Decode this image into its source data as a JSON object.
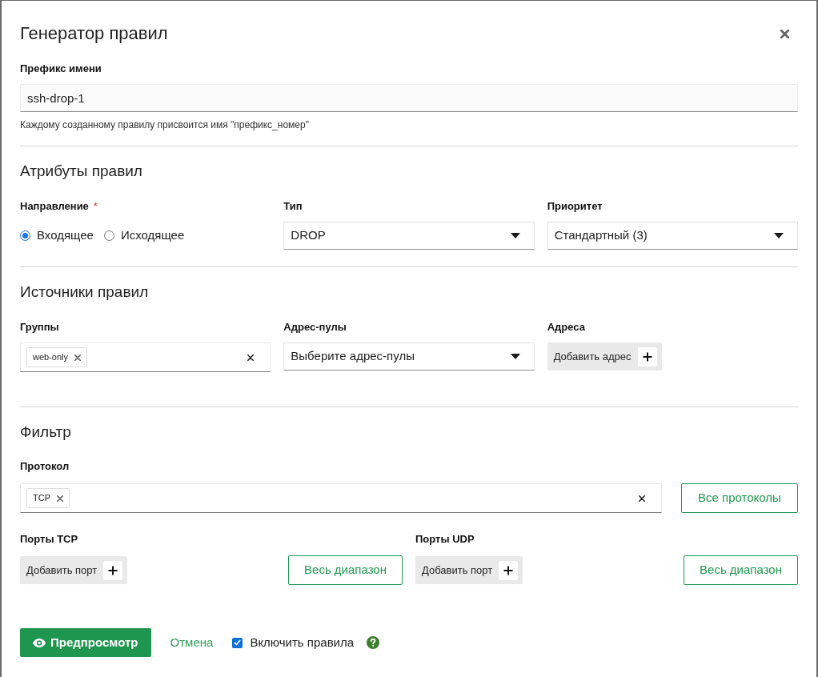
{
  "dialog": {
    "title": "Генератор правил"
  },
  "name_prefix": {
    "label": "Префикс имени",
    "value": "ssh-drop-1",
    "help": "Каждому созданному правилу присвоится имя \"префикс_номер\""
  },
  "rule_attributes": {
    "heading": "Атрибуты правил",
    "direction": {
      "label": "Направление",
      "required_mark": "*",
      "options": [
        {
          "label": "Входящее",
          "selected": true
        },
        {
          "label": "Исходящее",
          "selected": false
        }
      ]
    },
    "type": {
      "label": "Тип",
      "value": "DROP"
    },
    "priority": {
      "label": "Приоритет",
      "value": "Стандартный (3)"
    }
  },
  "rule_sources": {
    "heading": "Источники правил",
    "groups": {
      "label": "Группы",
      "tags": [
        "web-only"
      ]
    },
    "address_pools": {
      "label": "Адрес-пулы",
      "placeholder": "Выберите адрес-пулы"
    },
    "addresses": {
      "label": "Адреса",
      "add_button": "Добавить адрес"
    }
  },
  "filter": {
    "heading": "Фильтр",
    "protocol": {
      "label": "Протокол",
      "tags": [
        "TCP"
      ],
      "all_button": "Все протоколы"
    },
    "ports": [
      {
        "label": "Порты TCP",
        "add_button": "Добавить порт",
        "range_button": "Весь диапазон"
      },
      {
        "label": "Порты UDP",
        "add_button": "Добавить порт",
        "range_button": "Весь диапазон"
      }
    ]
  },
  "footer": {
    "preview_button": "Предпросмотр",
    "cancel_link": "Отмена",
    "enable_rules": {
      "label": "Включить правила",
      "checked": true
    }
  }
}
